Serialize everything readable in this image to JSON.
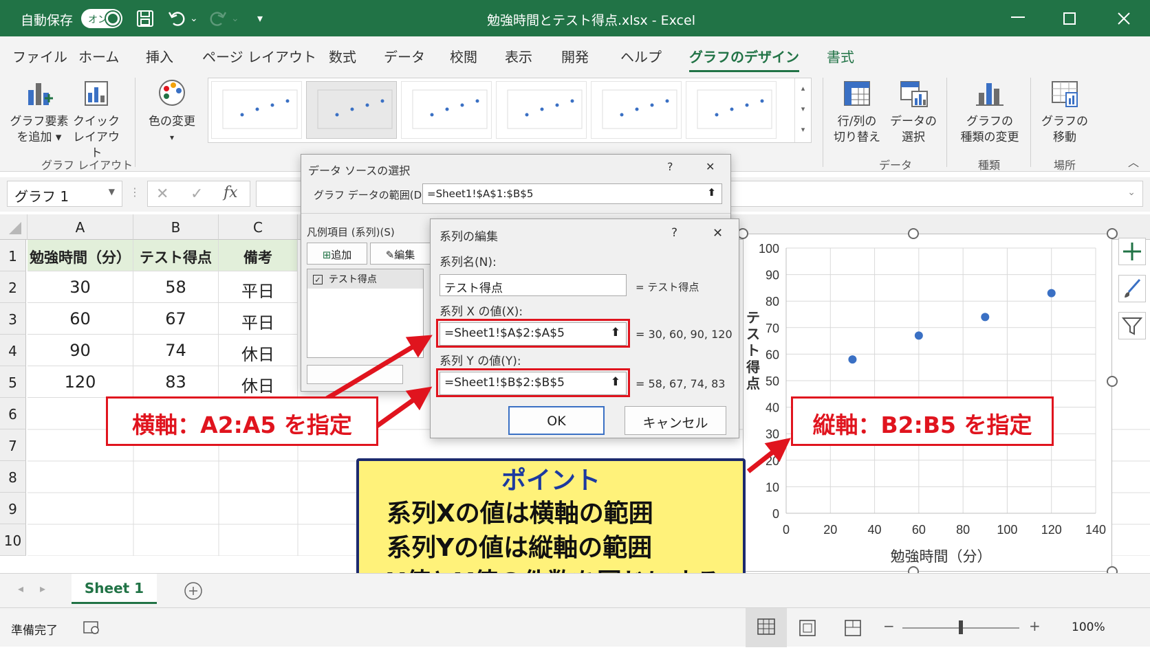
{
  "titlebar": {
    "autosave_label": "自動保存",
    "autosave_state": "オン",
    "title": "勉強時間とテスト得点.xlsx  -  Excel"
  },
  "tabs": [
    "ファイル",
    "ホーム",
    "挿入",
    "ページ レイアウト",
    "数式",
    "データ",
    "校閲",
    "表示",
    "開発",
    "ヘルプ",
    "グラフのデザイン",
    "書式"
  ],
  "ribbon": {
    "add_element_1": "グラフ要素",
    "add_element_2": "を追加 ▾",
    "quick_layout_1": "クイック",
    "quick_layout_2": "レイアウト",
    "change_color": "色の変更",
    "group_chart_layouts": "グラフ レイアウト",
    "switch_rowcol_1": "行/列の",
    "switch_rowcol_2": "切り替え",
    "select_data_1": "データの",
    "select_data_2": "選択",
    "change_type_1": "グラフの",
    "change_type_2": "種類の変更",
    "move_chart_1": "グラフの",
    "move_chart_2": "移動",
    "group_data": "データ",
    "group_type": "種類",
    "group_location": "場所"
  },
  "formula_bar": {
    "name_box": "グラフ 1",
    "fx": "fx"
  },
  "columns": [
    "A",
    "B",
    "C"
  ],
  "rows": [
    "1",
    "2",
    "3",
    "4",
    "5",
    "6",
    "7",
    "8",
    "9",
    "10"
  ],
  "table": {
    "headers": [
      "勉強時間（分）",
      "テスト得点",
      "備考"
    ],
    "rows": [
      [
        "30",
        "58",
        "平日"
      ],
      [
        "60",
        "67",
        "平日"
      ],
      [
        "90",
        "74",
        "休日"
      ],
      [
        "120",
        "83",
        "休日"
      ]
    ]
  },
  "datasource_dialog": {
    "title": "データ ソースの選択",
    "help": "?",
    "close": "✕",
    "range_label": "グラフ データの範囲(D):",
    "range_value": "=Sheet1!$A$1:$B$5",
    "legend_label": "凡例項目 (系列)(S)",
    "add_btn": "追加",
    "edit_btn": "編集",
    "series_item": "テスト得点"
  },
  "series_dialog": {
    "title": "系列の編集",
    "help": "?",
    "close": "✕",
    "name_label": "系列名(N):",
    "name_value": "テスト得点",
    "name_result": "= テスト得点",
    "x_label": "系列 X の値(X):",
    "x_value": "=Sheet1!$A$2:$A$5",
    "x_result": "= 30, 60, 90, 120",
    "y_label": "系列 Y の値(Y):",
    "y_value": "=Sheet1!$B$2:$B$5",
    "y_result": "= 58, 67, 74, 83",
    "ok": "OK",
    "cancel": "キャンセル"
  },
  "callouts": {
    "horizontal": "横軸：A2:A5 を指定",
    "vertical": "縦軸：B2:B5 を指定"
  },
  "point_box": {
    "title": "ポイント",
    "line1": "系列Xの値は横軸の範囲",
    "line2": "系列Yの値は縦軸の範囲",
    "line3": "X値とY値の件数を同じにする"
  },
  "chart_data": {
    "type": "scatter",
    "x": [
      30,
      60,
      90,
      120
    ],
    "y": [
      58,
      67,
      74,
      83
    ],
    "xlabel": "勉強時間（分）",
    "ylabel": "テスト得点",
    "xlim": [
      0,
      140
    ],
    "ylim": [
      0,
      100
    ],
    "xticks": [
      0,
      20,
      40,
      60,
      80,
      100,
      120,
      140
    ],
    "yticks": [
      0,
      10,
      20,
      30,
      40,
      50,
      60,
      70,
      80,
      90,
      100
    ],
    "grid": true,
    "marker_color": "#3a70c4"
  },
  "sheet_tab": "Sheet 1",
  "status": {
    "ready": "準備完了",
    "zoom": "100%"
  },
  "colors": {
    "excel_green": "#217346",
    "accent_red": "#e0141e",
    "point_bg": "#fff27a",
    "point_border": "#1c2a6e"
  }
}
